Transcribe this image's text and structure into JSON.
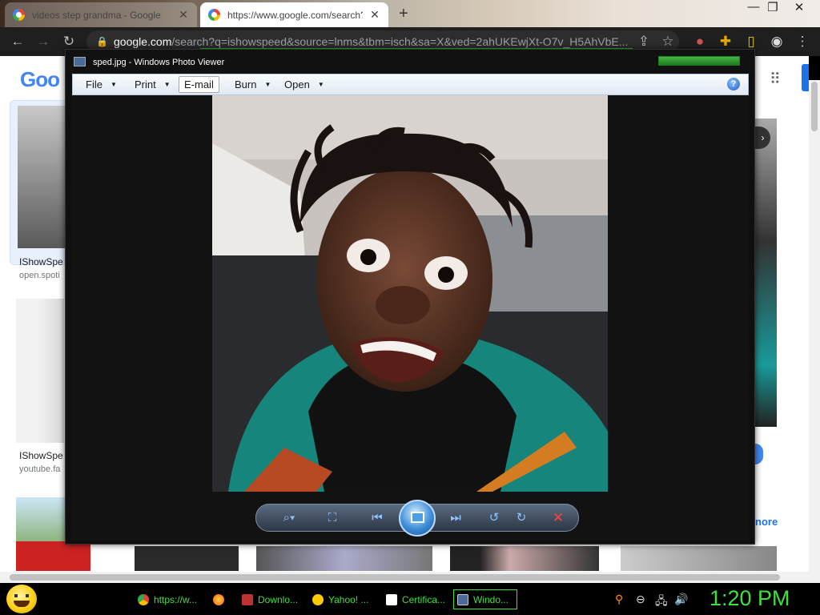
{
  "browser": {
    "tabs": [
      {
        "title": "videos step grandma - Google"
      },
      {
        "title": "https://www.google.com/search?"
      }
    ],
    "new_tab": "+",
    "window_controls": [
      "—",
      "❐",
      "✕"
    ],
    "nav": {
      "back": "←",
      "forward": "→",
      "reload": "↻"
    },
    "omnibox": {
      "domain": "google.com",
      "path": "/search?q=ishowspeed&source=lnms&tbm=isch&sa=X&ved=2ahUKEwjXt-O7v_H5AhVbE..."
    }
  },
  "google": {
    "logo": "Goo",
    "results": [
      {
        "caption": "IShowSpe",
        "source": "open.spoti"
      },
      {
        "caption": "IShowSpe",
        "source": "youtube.fa"
      }
    ],
    "more_link": "nore"
  },
  "photo_viewer": {
    "title": "sped.jpg - Windows Photo Viewer",
    "menu": [
      {
        "label": "File",
        "has_arrow": true
      },
      {
        "label": "Print",
        "has_arrow": true
      },
      {
        "label": "E-mail",
        "has_arrow": false
      },
      {
        "label": "Burn",
        "has_arrow": true
      },
      {
        "label": "Open",
        "has_arrow": true
      }
    ],
    "help": "?",
    "toolbar": {
      "zoom": "⌕▾",
      "actual_size": "⛶",
      "previous": "⏮",
      "next": "⏭",
      "rotate_ccw": "↺",
      "rotate_cw": "↻",
      "delete": "✕"
    }
  },
  "taskbar": {
    "items": [
      {
        "label": "https://w...",
        "color": "#4285f4"
      },
      {
        "label": "",
        "color": "#ff7a00"
      },
      {
        "label": "Downlo...",
        "color": "#b33"
      },
      {
        "label": "Yahoo! ...",
        "color": "#ffcc00"
      },
      {
        "label": "Certifica...",
        "color": "#ffffff"
      },
      {
        "label": "Windo...",
        "color": "#4a6a99"
      }
    ],
    "clock": "1:20 PM"
  }
}
